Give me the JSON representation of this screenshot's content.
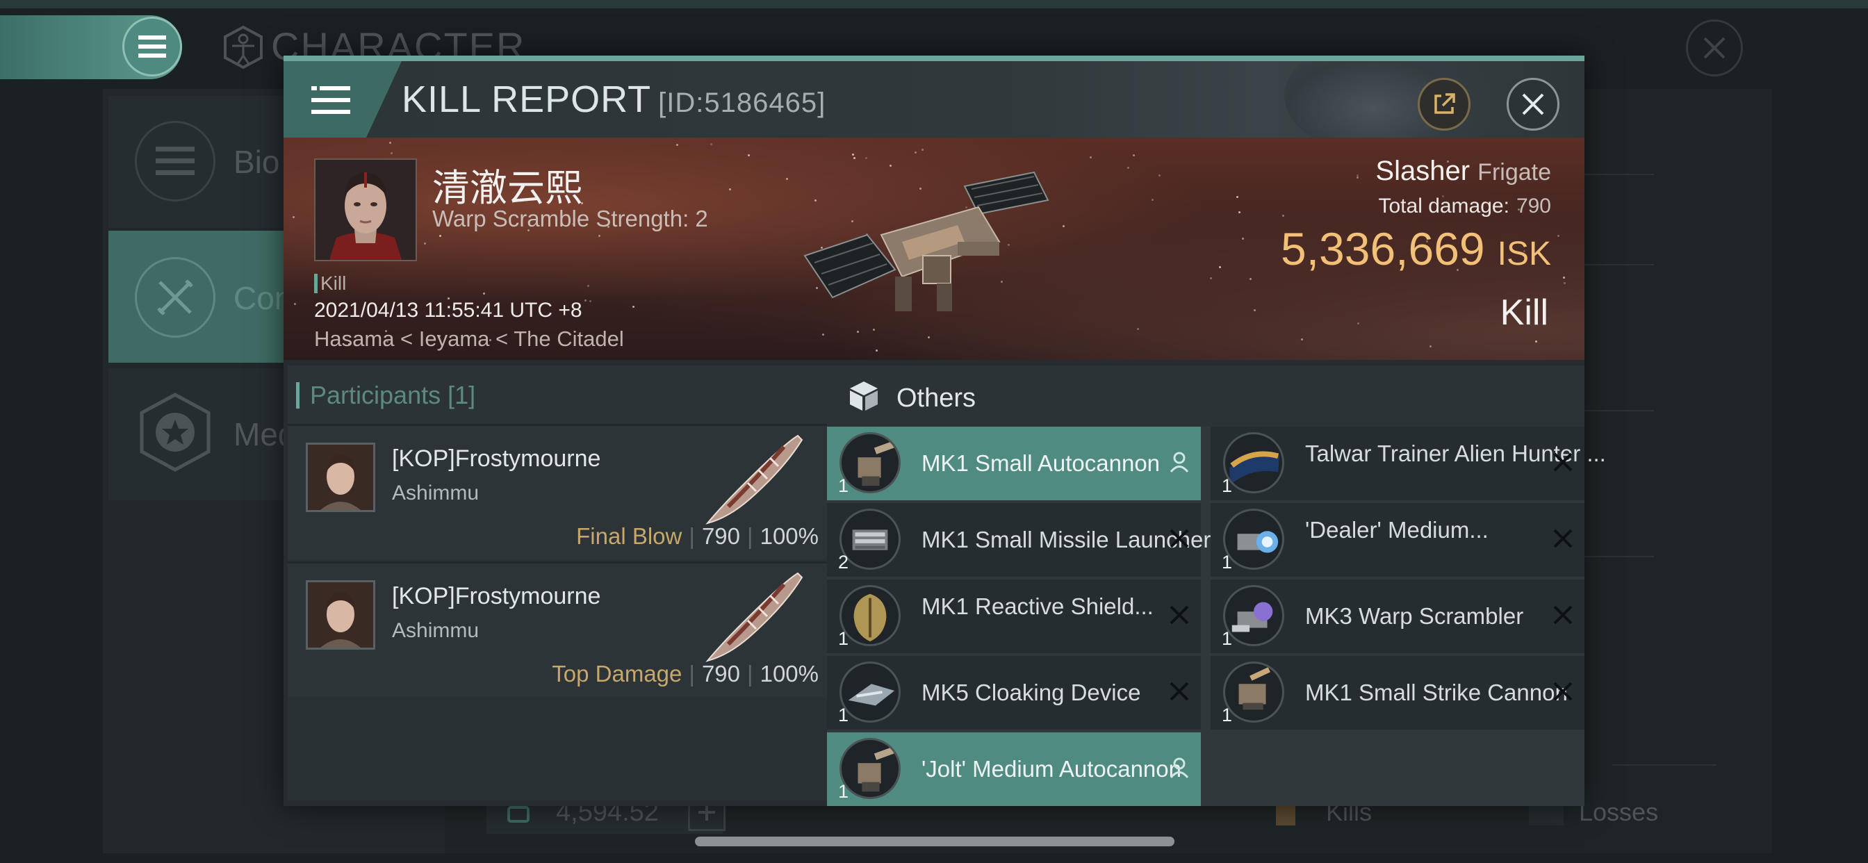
{
  "background": {
    "title": "CHARACTER",
    "menu_items": [
      {
        "label": "Bio",
        "icon": "list-icon"
      },
      {
        "label": "Con",
        "icon": "crossed-swords-icon"
      },
      {
        "label": "Med",
        "icon": "star-medal-icon"
      }
    ],
    "isk_value": "4,594.52",
    "kills_label": "Kills",
    "losses_label": "Losses"
  },
  "header": {
    "title": "KILL REPORT",
    "id": "[ID:5186465]"
  },
  "victim": {
    "name": "清澈云熙",
    "warp_scramble": "Warp Scramble Strength: 2",
    "tag": "Kill",
    "time": "2021/04/13 11:55:41 UTC +8",
    "location": "Hasama < Ieyama < The Citadel",
    "ship": "Slasher",
    "ship_class": "Frigate",
    "total_damage_label": "Total damage:",
    "total_damage": "790",
    "isk_value": "5,336,669",
    "isk_unit": "ISK",
    "result": "Kill"
  },
  "participants": {
    "title": "Participants",
    "count": "[1]",
    "rows": [
      {
        "name": "[KOP]Frostymourne",
        "ship": "Ashimmu",
        "role": "Final Blow",
        "damage": "790",
        "percent": "100%"
      },
      {
        "name": "[KOP]Frostymourne",
        "ship": "Ashimmu",
        "role": "Top Damage",
        "damage": "790",
        "percent": "100%"
      }
    ]
  },
  "others": {
    "title": "Others",
    "items": [
      {
        "name": "MK1 Small Autocannon",
        "qty": "1",
        "status": "fitted",
        "icon": "autocannon-icon",
        "highlight": true
      },
      {
        "name": "Talwar Trainer Alien Hunter ...",
        "qty": "1",
        "status": "destroyed",
        "icon": "ship-skin-icon",
        "highlight": false
      },
      {
        "name": "MK1 Small Missile Launcher",
        "qty": "2",
        "status": "destroyed",
        "icon": "missile-launcher-icon",
        "highlight": false
      },
      {
        "name": "'Dealer' Medium...",
        "qty": "1",
        "status": "destroyed",
        "icon": "energy-weapon-icon",
        "highlight": false
      },
      {
        "name": "MK1 Reactive Shield...",
        "qty": "1",
        "status": "destroyed",
        "icon": "shield-icon",
        "highlight": false
      },
      {
        "name": "MK3 Warp Scrambler",
        "qty": "1",
        "status": "destroyed",
        "icon": "warp-scrambler-icon",
        "highlight": false
      },
      {
        "name": "MK5 Cloaking Device",
        "qty": "1",
        "status": "destroyed",
        "icon": "cloaking-device-icon",
        "highlight": false
      },
      {
        "name": "MK1 Small Strike Cannon",
        "qty": "1",
        "status": "destroyed",
        "icon": "strike-cannon-icon",
        "highlight": false
      },
      {
        "name": "'Jolt' Medium Autocannon",
        "qty": "1",
        "status": "fitted",
        "icon": "autocannon-icon",
        "highlight": true
      }
    ]
  },
  "colors": {
    "accent": "#6aa69b",
    "highlight": "#4f8b80",
    "isk": "#f3c077",
    "role": "#c8a76a"
  }
}
